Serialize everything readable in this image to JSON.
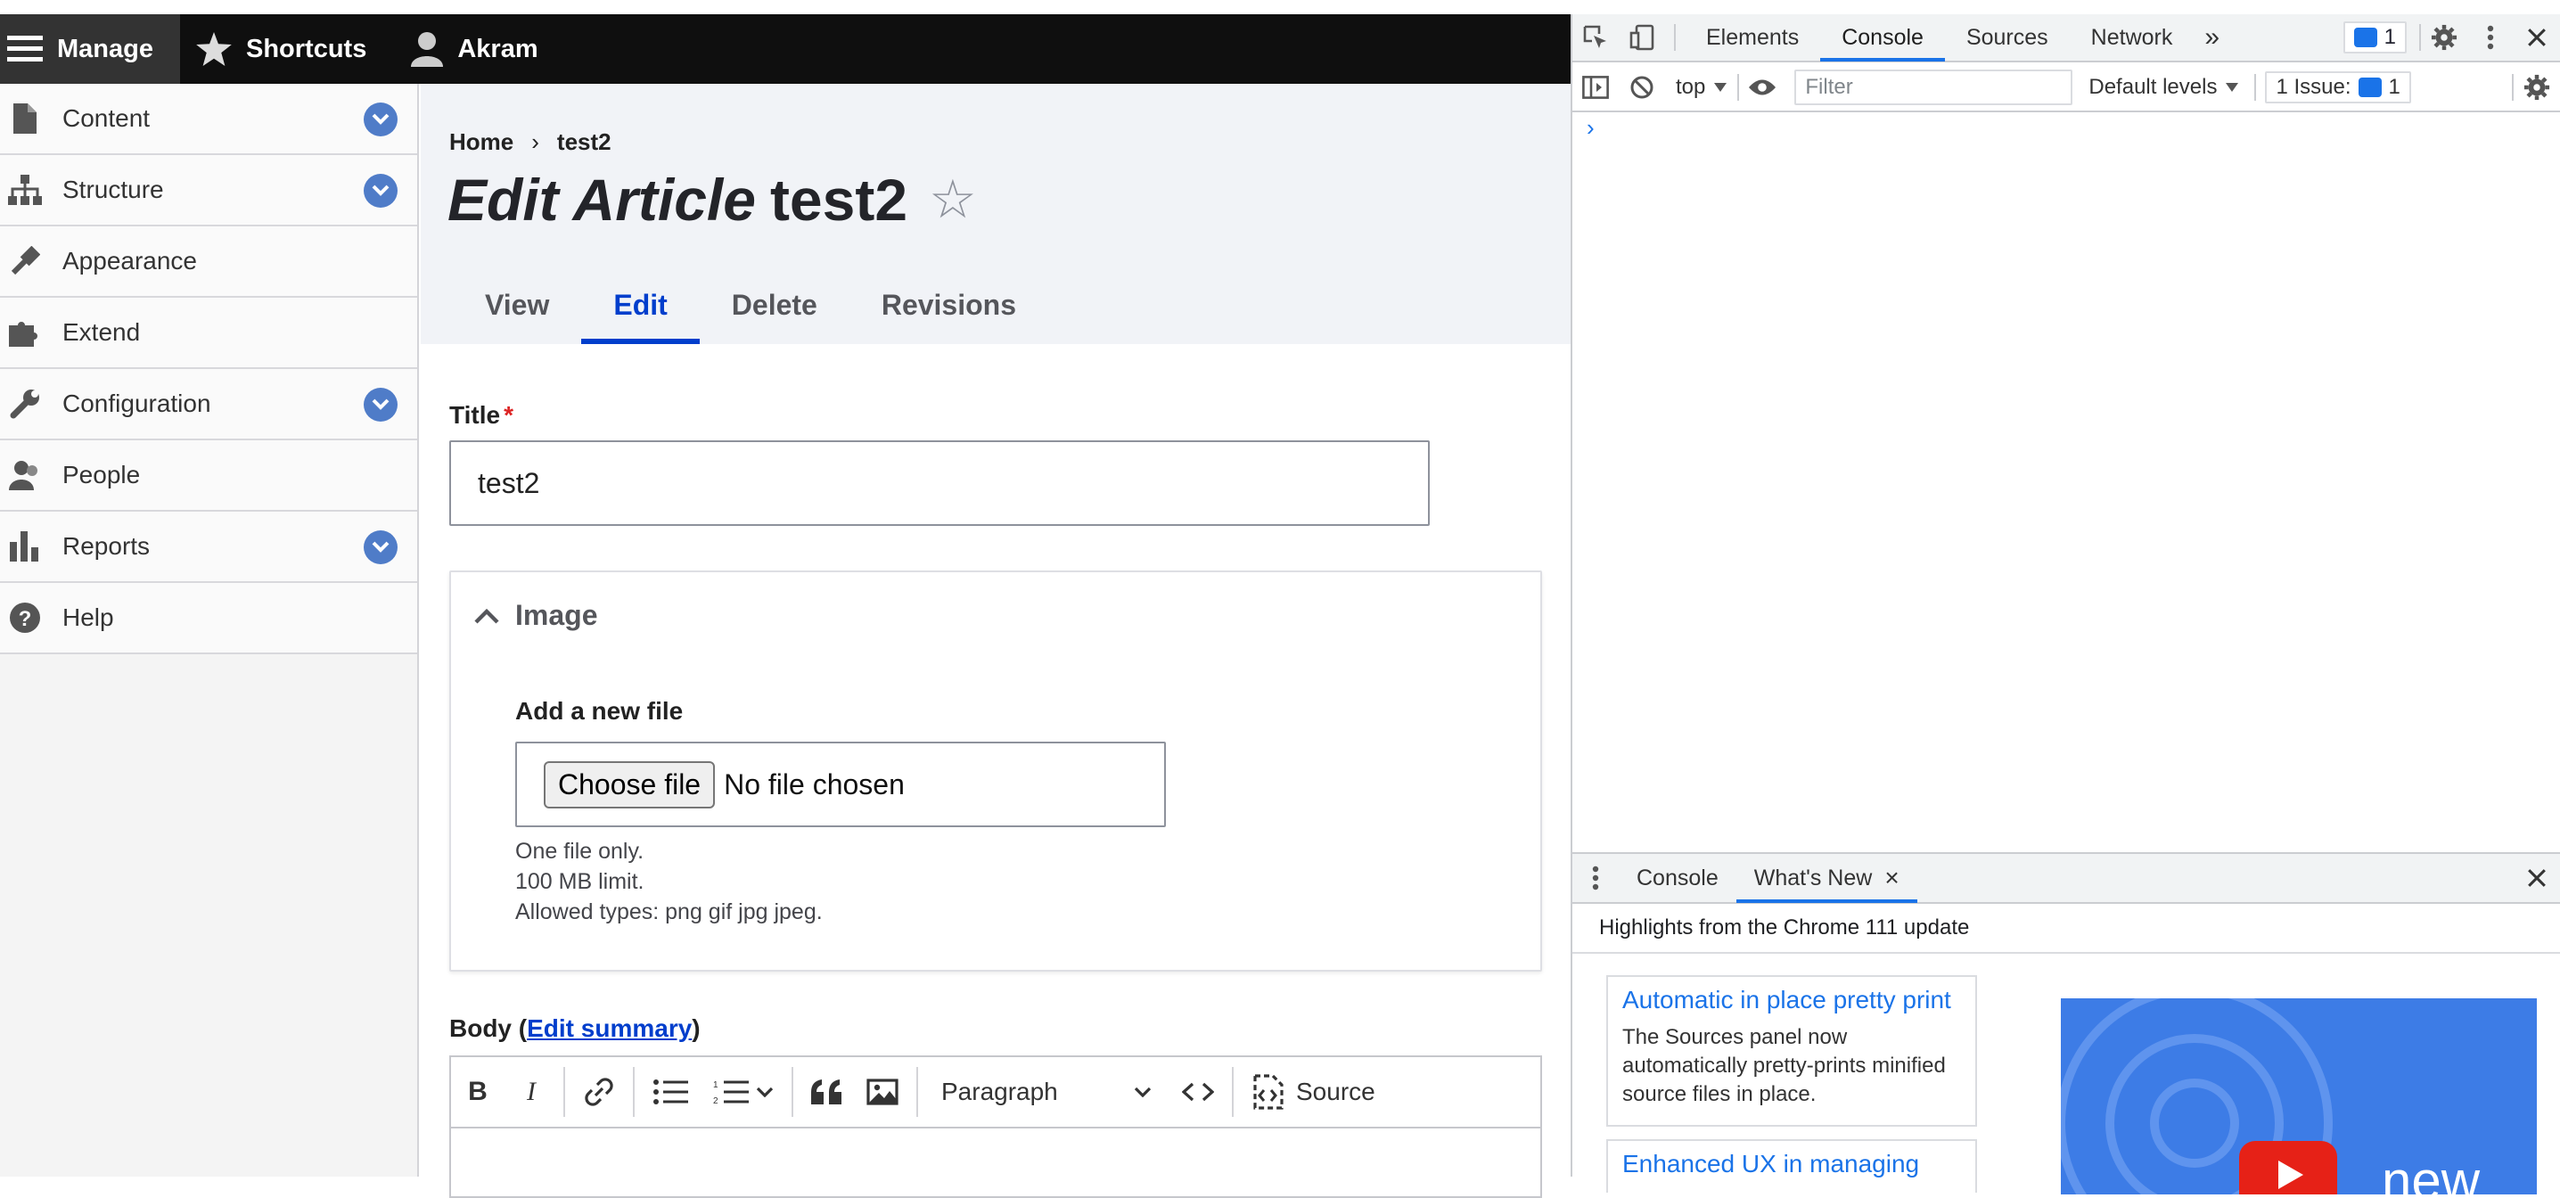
{
  "toolbar": {
    "manage": "Manage",
    "shortcuts": "Shortcuts",
    "user": "Akram"
  },
  "sidebar": {
    "items": [
      {
        "label": "Content",
        "icon": "file-icon",
        "expandable": true
      },
      {
        "label": "Structure",
        "icon": "sitemap-icon",
        "expandable": true
      },
      {
        "label": "Appearance",
        "icon": "paint-brush-icon",
        "expandable": false
      },
      {
        "label": "Extend",
        "icon": "puzzle-icon",
        "expandable": false
      },
      {
        "label": "Configuration",
        "icon": "wrench-icon",
        "expandable": true
      },
      {
        "label": "People",
        "icon": "people-icon",
        "expandable": false
      },
      {
        "label": "Reports",
        "icon": "bar-chart-icon",
        "expandable": true
      },
      {
        "label": "Help",
        "icon": "question-icon",
        "expandable": false
      }
    ]
  },
  "breadcrumb": {
    "home": "Home",
    "separator": "›",
    "current": "test2"
  },
  "page": {
    "title_prefix": "Edit Article",
    "title_name": "test2",
    "star": "☆"
  },
  "tabs": [
    {
      "label": "View"
    },
    {
      "label": "Edit",
      "active": true
    },
    {
      "label": "Delete"
    },
    {
      "label": "Revisions"
    }
  ],
  "form": {
    "title_label": "Title",
    "required_mark": "*",
    "title_value": "test2",
    "image": {
      "legend": "Image",
      "add_label": "Add a new file",
      "choose_button": "Choose file",
      "no_file": "No file chosen",
      "help": [
        "One file only.",
        "100 MB limit.",
        "Allowed types: png gif jpg jpeg."
      ]
    },
    "body": {
      "label": "Body (",
      "link": "Edit summary",
      "close": ")",
      "paragraph": "Paragraph",
      "source": "Source"
    }
  },
  "devtools": {
    "tabs": [
      "Elements",
      "Console",
      "Sources",
      "Network"
    ],
    "active_tab": "Console",
    "more": "»",
    "issue_count": "1",
    "context": "top",
    "filter_placeholder": "Filter",
    "levels": "Default levels",
    "issues_label": "1 Issue:",
    "issues_count": "1",
    "prompt": "›",
    "drawer": {
      "tabs": [
        "Console",
        "What's New"
      ],
      "active": "What's New",
      "close_tab": "×",
      "header": "Highlights from the Chrome 111 update",
      "cards": [
        {
          "title": "Automatic in place pretty print",
          "desc": "The Sources panel now automatically pretty-prints minified source files in place."
        },
        {
          "title": "Enhanced UX in managing",
          "desc": ""
        }
      ],
      "video_text": "new"
    }
  },
  "colors": {
    "accent": "#003ecc",
    "chevron_blue": "#4f7cc8",
    "devtools_blue": "#1a73e8",
    "required_red": "#dc2323"
  }
}
